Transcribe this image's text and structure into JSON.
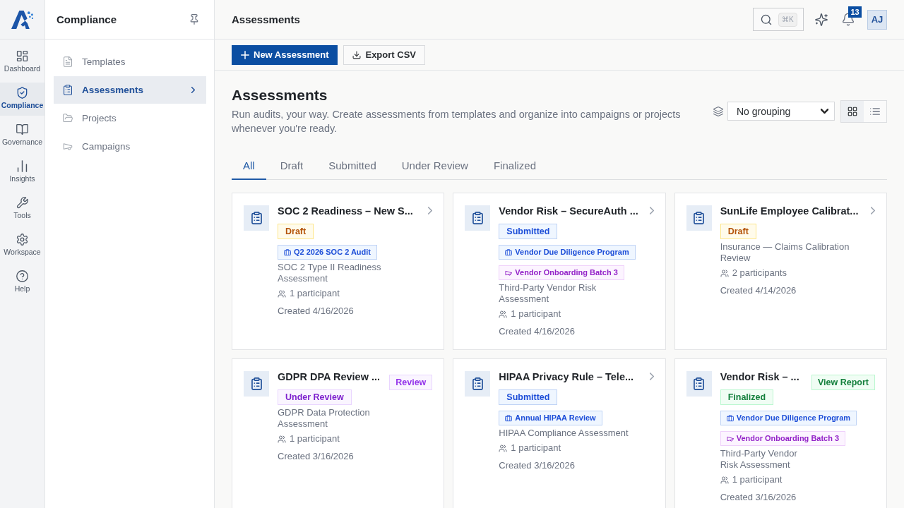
{
  "rail": {
    "items": [
      {
        "label": "Dashboard",
        "selected": false
      },
      {
        "label": "Compliance",
        "selected": true
      },
      {
        "label": "Governance",
        "selected": false
      },
      {
        "label": "Insights",
        "selected": false
      },
      {
        "label": "Tools",
        "selected": false
      },
      {
        "label": "Workspace",
        "selected": false
      },
      {
        "label": "Help",
        "selected": false
      }
    ]
  },
  "sidebar": {
    "title": "Compliance",
    "items": [
      {
        "label": "Templates",
        "selected": false
      },
      {
        "label": "Assessments",
        "selected": true
      },
      {
        "label": "Projects",
        "selected": false
      },
      {
        "label": "Campaigns",
        "selected": false
      }
    ]
  },
  "topbar": {
    "title": "Assessments",
    "search": {
      "shortcut": "⌘K"
    },
    "notifications": {
      "count": "13"
    },
    "avatar": {
      "initials": "AJ"
    }
  },
  "toolbar": {
    "buttons": [
      {
        "kind": "primary",
        "label": "New Assessment"
      },
      {
        "kind": "secondary",
        "label": "Export CSV"
      }
    ]
  },
  "header": {
    "title": "Assessments",
    "description": "Run audits, your way. Create assessments from templates and organize into campaigns or projects whenever you're ready.",
    "grouping": {
      "value": "No grouping"
    },
    "views": [
      {
        "kind": "grid",
        "selected": true
      },
      {
        "kind": "list",
        "selected": false
      }
    ]
  },
  "tabs": [
    {
      "label": "All",
      "selected": true
    },
    {
      "label": "Draft",
      "selected": false
    },
    {
      "label": "Submitted",
      "selected": false
    },
    {
      "label": "Under Review",
      "selected": false
    },
    {
      "label": "Finalized",
      "selected": false
    }
  ],
  "cards": [
    {
      "title": "SOC 2 Readiness – New S...",
      "status": {
        "kind": "draft",
        "label": "Draft"
      },
      "tags": [
        {
          "kind": "project",
          "label": "Q2 2026 SOC 2 Audit"
        }
      ],
      "template": "SOC 2 Type II Readiness Assessment",
      "participants": "1 participant",
      "created": "Created 4/16/2026",
      "action": {
        "kind": "open"
      }
    },
    {
      "title": "Vendor Risk – SecureAuth ...",
      "status": {
        "kind": "submitted",
        "label": "Submitted"
      },
      "tags": [
        {
          "kind": "project",
          "label": "Vendor Due Diligence Program"
        },
        {
          "kind": "campaign",
          "label": "Vendor Onboarding Batch 3"
        }
      ],
      "template": "Third-Party Vendor Risk Assessment",
      "participants": "1 participant",
      "created": "Created 4/16/2026",
      "action": {
        "kind": "open"
      }
    },
    {
      "title": "SunLife Employee Calibrat...",
      "status": {
        "kind": "draft",
        "label": "Draft"
      },
      "template": "Insurance — Claims Calibration Review",
      "participants": "2 participants",
      "created": "Created 4/14/2026",
      "action": {
        "kind": "open"
      }
    },
    {
      "title": "GDPR DPA Review ...",
      "status": {
        "kind": "under_review",
        "label": "Under Review"
      },
      "template": "GDPR Data Protection Assessment",
      "participants": "1 participant",
      "created": "Created 3/16/2026",
      "action": {
        "kind": "review",
        "label": "Review"
      }
    },
    {
      "title": "HIPAA Privacy Rule – Tele...",
      "status": {
        "kind": "submitted",
        "label": "Submitted"
      },
      "tags": [
        {
          "kind": "project",
          "label": "Annual HIPAA Review"
        }
      ],
      "template": "HIPAA Compliance Assessment",
      "participants": "1 participant",
      "created": "Created 3/16/2026",
      "action": {
        "kind": "open"
      }
    },
    {
      "title": "Vendor Risk – ...",
      "status": {
        "kind": "finalized",
        "label": "Finalized"
      },
      "tags": [
        {
          "kind": "project",
          "label": "Vendor Due Diligence Program"
        },
        {
          "kind": "campaign",
          "label": "Vendor Onboarding Batch 3"
        }
      ],
      "template": "Third-Party Vendor Risk Assessment",
      "participants": "1 participant",
      "created": "Created 3/16/2026",
      "action": {
        "kind": "report",
        "label": "View Report"
      }
    }
  ]
}
